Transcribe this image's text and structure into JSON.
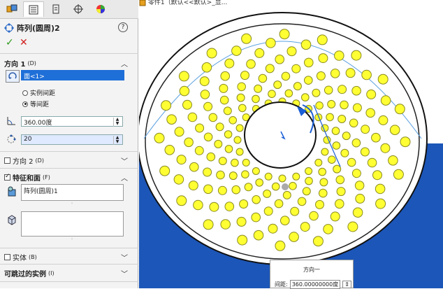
{
  "feature": {
    "title": "阵列(圆周)2",
    "help": "?"
  },
  "direction1": {
    "header": "方向 1",
    "header_sub": "(D)",
    "face_ref": "面<1>",
    "radio_instance_spacing": "实例间距",
    "radio_equal_spacing": "等间距",
    "angle_value": "360.00度",
    "count_value": "20"
  },
  "direction2": {
    "header": "方向 2",
    "header_sub": "(D)"
  },
  "features_faces": {
    "header": "特征和面",
    "header_sub": "(F)",
    "feature_item": "阵列(圆周)1"
  },
  "bodies": {
    "header": "实体",
    "header_sub": "(B)"
  },
  "skip_instances": {
    "header": "可跳过的实例",
    "header_sub": "(I)"
  },
  "breadcrumb": "零件1（默认<<默认>_显...",
  "popup": {
    "title": "方向一",
    "spacing_label": "间距:",
    "spacing_value": "360.00000000度"
  },
  "colors": {
    "hole_fill": "#ffff33",
    "hole_stroke": "#8a8a20",
    "cylinder_blue": "#1c56b8",
    "selection_blue": "#1a5fd6"
  }
}
